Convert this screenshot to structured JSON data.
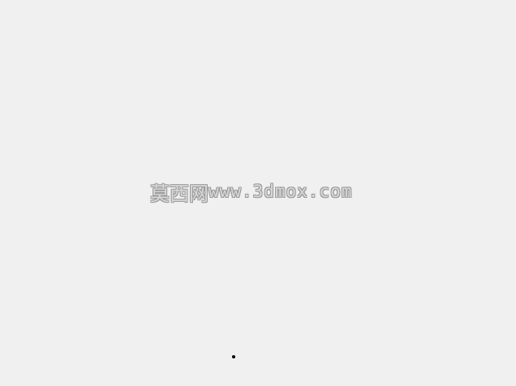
{
  "background_color": "#f0f0f0",
  "watermark": {
    "text": "莫西网www.3dmox.com",
    "cjk_part": "莫西网",
    "url_part": "www.3dmox.com",
    "fill_color": "#d9d9d9",
    "outline_color": "#9a9a9a"
  },
  "cursor": {
    "icon": "cursor-dot-icon",
    "color": "#000000"
  }
}
